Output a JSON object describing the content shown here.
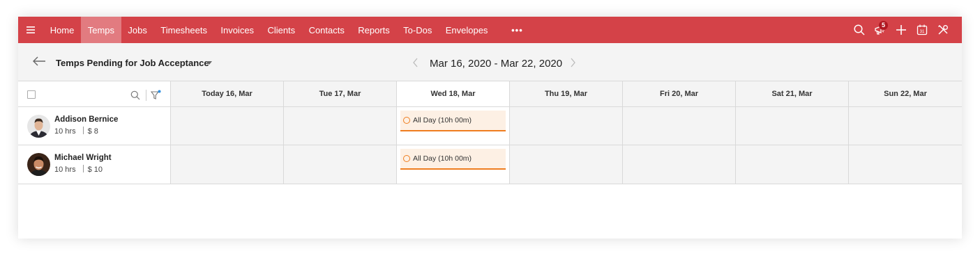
{
  "colors": {
    "nav_bg": "#d44248",
    "nav_active": "#e27b80",
    "shift_accent": "#ef7d1f",
    "badge": "#b01822"
  },
  "topnav": {
    "menu_icon": "hamburger-icon",
    "items": [
      {
        "label": "Home",
        "active": false
      },
      {
        "label": "Temps",
        "active": true
      },
      {
        "label": "Jobs",
        "active": false
      },
      {
        "label": "Timesheets",
        "active": false
      },
      {
        "label": "Invoices",
        "active": false
      },
      {
        "label": "Clients",
        "active": false
      },
      {
        "label": "Contacts",
        "active": false
      },
      {
        "label": "Reports",
        "active": false
      },
      {
        "label": "To-Dos",
        "active": false
      },
      {
        "label": "Envelopes",
        "active": false
      }
    ],
    "more_label": "•••",
    "right_icons": [
      "search-icon",
      "announcement-icon",
      "plus-icon",
      "calendar-icon",
      "tools-icon"
    ],
    "notification_count": "5",
    "calendar_day": "31"
  },
  "subheader": {
    "view_title": "Temps Pending for Job Acceptance",
    "date_range": "Mar 16, 2020 - Mar 22, 2020"
  },
  "grid": {
    "days": [
      "Today 16, Mar",
      "Tue 17, Mar",
      "Wed 18, Mar",
      "Thu 19, Mar",
      "Fri 20, Mar",
      "Sat 21, Mar",
      "Sun 22, Mar"
    ],
    "highlighted_day_index": 2,
    "temps": [
      {
        "name": "Addison Bernice",
        "hours": "10 hrs",
        "rate": "$ 8",
        "shift": {
          "day_index": 2,
          "label": "All Day (10h 00m)"
        }
      },
      {
        "name": "Michael Wright",
        "hours": "10 hrs",
        "rate": "$ 10",
        "shift": {
          "day_index": 2,
          "label": "All Day (10h 00m)"
        }
      }
    ]
  }
}
